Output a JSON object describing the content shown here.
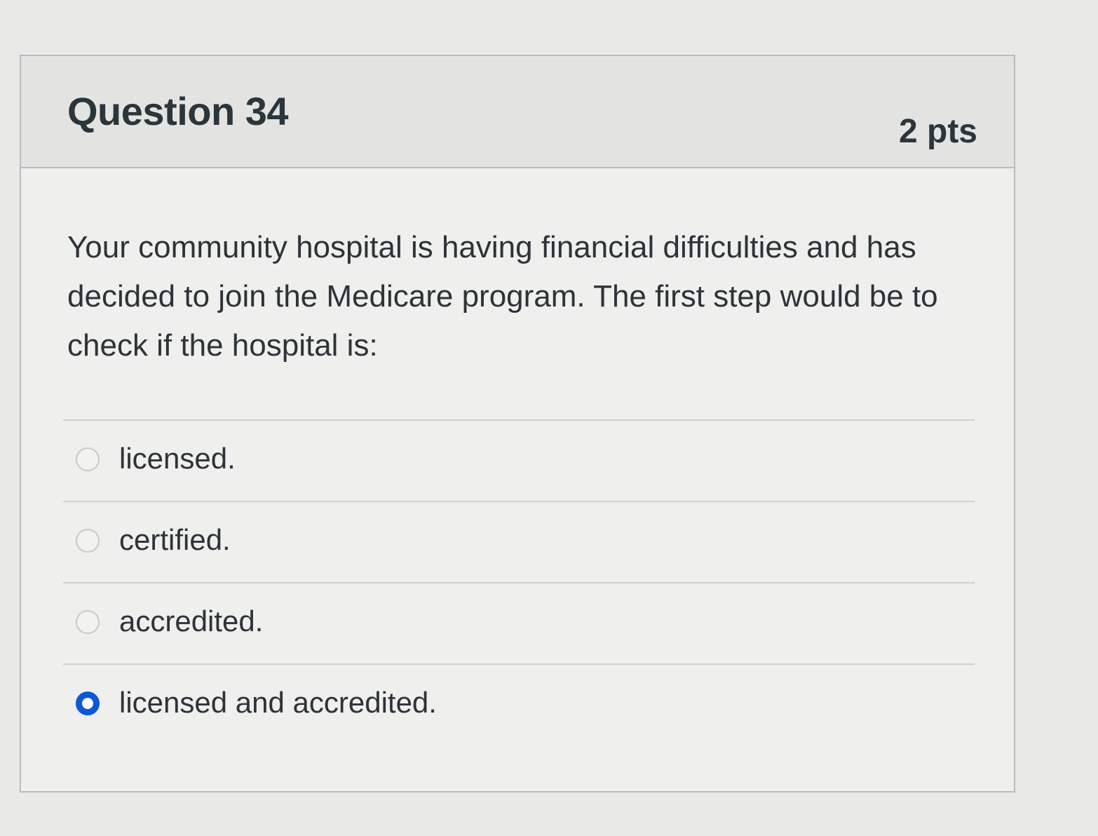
{
  "question": {
    "title": "Question 34",
    "points": "2 pts",
    "text": "Your community hospital is having financial difficulties and has decided to join the Medicare program. The first step would be to check if the hospital is:"
  },
  "answers": [
    {
      "label": "licensed.",
      "selected": false
    },
    {
      "label": "certified.",
      "selected": false
    },
    {
      "label": "accredited.",
      "selected": false
    },
    {
      "label": "licensed and accredited.",
      "selected": true
    }
  ],
  "colors": {
    "selected_radio": "#0c58d6"
  }
}
